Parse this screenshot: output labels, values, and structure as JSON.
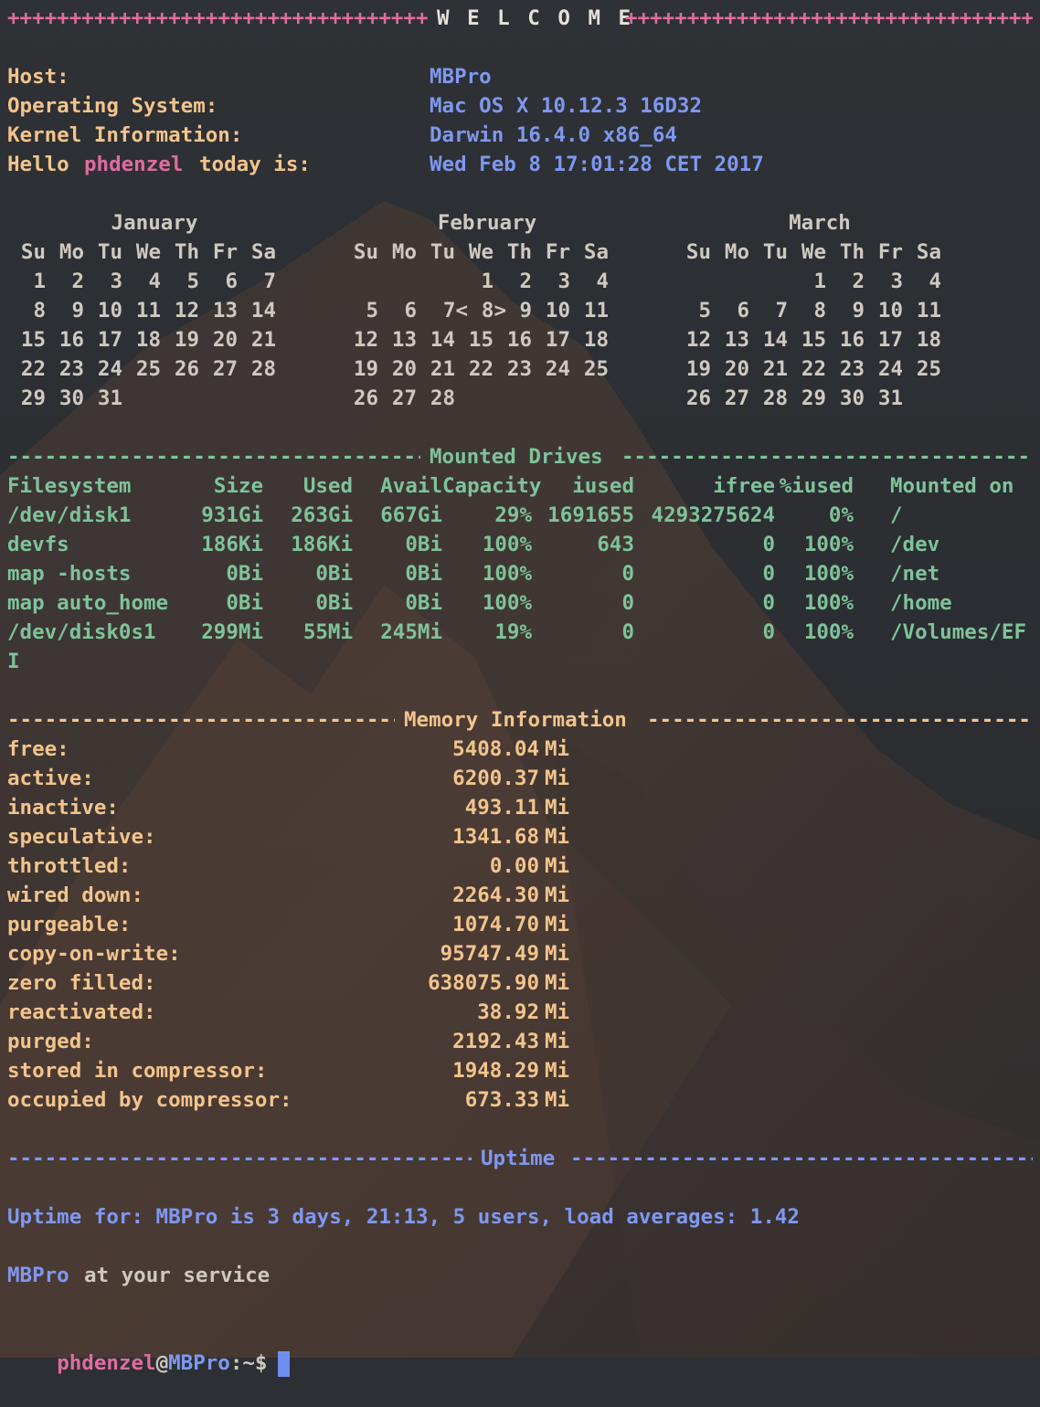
{
  "banner": {
    "title": "W E L C O M E",
    "fill_char": "+"
  },
  "system_info": [
    {
      "label": "Host:",
      "value": "MBPro"
    },
    {
      "label": "Operating System:",
      "value": "Mac OS X 10.12.3 16D32"
    },
    {
      "label": "Kernel Information:",
      "value": "Darwin 16.4.0 x86_64"
    }
  ],
  "greeting": {
    "prefix": "Hello",
    "user": "phdenzel",
    "suffix": "today is:",
    "date": "Wed Feb 8 17:01:28 CET 2017"
  },
  "calendars": [
    {
      "month": "January",
      "days_header": [
        "Su",
        "Mo",
        "Tu",
        "We",
        "Th",
        "Fr",
        "Sa"
      ],
      "weeks": [
        [
          "1",
          "2",
          "3",
          "4",
          "5",
          "6",
          "7"
        ],
        [
          "8",
          "9",
          "10",
          "11",
          "12",
          "13",
          "14"
        ],
        [
          "15",
          "16",
          "17",
          "18",
          "19",
          "20",
          "21"
        ],
        [
          "22",
          "23",
          "24",
          "25",
          "26",
          "27",
          "28"
        ],
        [
          "29",
          "30",
          "31",
          "",
          "",
          "",
          ""
        ]
      ]
    },
    {
      "month": "February",
      "days_header": [
        "Su",
        "Mo",
        "Tu",
        "We",
        "Th",
        "Fr",
        "Sa"
      ],
      "weeks": [
        [
          "",
          "",
          "",
          "1",
          "2",
          "3",
          "4"
        ],
        [
          "5",
          "6",
          "7<",
          "8>",
          "9",
          "10",
          "11"
        ],
        [
          "12",
          "13",
          "14",
          "15",
          "16",
          "17",
          "18"
        ],
        [
          "19",
          "20",
          "21",
          "22",
          "23",
          "24",
          "25"
        ],
        [
          "26",
          "27",
          "28",
          "",
          "",
          "",
          ""
        ]
      ]
    },
    {
      "month": "March",
      "days_header": [
        "Su",
        "Mo",
        "Tu",
        "We",
        "Th",
        "Fr",
        "Sa"
      ],
      "weeks": [
        [
          "",
          "",
          "",
          "1",
          "2",
          "3",
          "4"
        ],
        [
          "5",
          "6",
          "7",
          "8",
          "9",
          "10",
          "11"
        ],
        [
          "12",
          "13",
          "14",
          "15",
          "16",
          "17",
          "18"
        ],
        [
          "19",
          "20",
          "21",
          "22",
          "23",
          "24",
          "25"
        ],
        [
          "26",
          "27",
          "28",
          "29",
          "30",
          "31",
          ""
        ]
      ]
    }
  ],
  "drives": {
    "section_title": "Mounted Drives",
    "fill_char": "-",
    "headers": [
      "Filesystem",
      "Size",
      "Used",
      "Avail",
      "Capacity",
      "iused",
      "ifree",
      "%iused",
      "Mounted on"
    ],
    "rows": [
      [
        "/dev/disk1",
        "931Gi",
        "263Gi",
        "667Gi",
        "29%",
        "1691655",
        "4293275624",
        "0%",
        "/"
      ],
      [
        "devfs",
        "186Ki",
        "186Ki",
        "0Bi",
        "100%",
        "643",
        "0",
        "100%",
        "/dev"
      ],
      [
        "map -hosts",
        "0Bi",
        "0Bi",
        "0Bi",
        "100%",
        "0",
        "0",
        "100%",
        "/net"
      ],
      [
        "map auto_home",
        "0Bi",
        "0Bi",
        "0Bi",
        "100%",
        "0",
        "0",
        "100%",
        "/home"
      ],
      [
        "/dev/disk0s1",
        "299Mi",
        "55Mi",
        "245Mi",
        "19%",
        "0",
        "0",
        "100%",
        "/Volumes/EF"
      ]
    ],
    "wrap_continuation": "I"
  },
  "memory": {
    "section_title": "Memory Information",
    "fill_char": "-",
    "unit": "Mi",
    "rows": [
      {
        "label": "free:",
        "value": "5408.04"
      },
      {
        "label": "active:",
        "value": "6200.37"
      },
      {
        "label": "inactive:",
        "value": "493.11"
      },
      {
        "label": "speculative:",
        "value": "1341.68"
      },
      {
        "label": "throttled:",
        "value": "0.00"
      },
      {
        "label": "wired down:",
        "value": "2264.30"
      },
      {
        "label": "purgeable:",
        "value": "1074.70"
      },
      {
        "label": "copy-on-write:",
        "value": "95747.49"
      },
      {
        "label": "zero filled:",
        "value": "638075.90"
      },
      {
        "label": "reactivated:",
        "value": "38.92"
      },
      {
        "label": "purged:",
        "value": "2192.43"
      },
      {
        "label": "stored in compressor:",
        "value": "1948.29"
      },
      {
        "label": "occupied by compressor:",
        "value": "673.33"
      }
    ]
  },
  "uptime": {
    "section_title": "Uptime",
    "fill_char": "-",
    "text": "Uptime for: MBPro is 3 days, 21:13, 5 users, load averages: 1.42"
  },
  "service_line": {
    "host": "MBPro",
    "text": "at your service"
  },
  "prompt": {
    "user": "phdenzel",
    "at": "@",
    "host": "MBPro",
    "path": ":~$"
  },
  "colors": {
    "label_yellow": "#f3c48c",
    "value_blue": "#7f98f0",
    "drives_green": "#7fc39a",
    "user_pink": "#e06c9f",
    "banner_white": "#e6e1d8",
    "cursor_blue": "#6f8ef2",
    "background": "#2c2f33"
  }
}
